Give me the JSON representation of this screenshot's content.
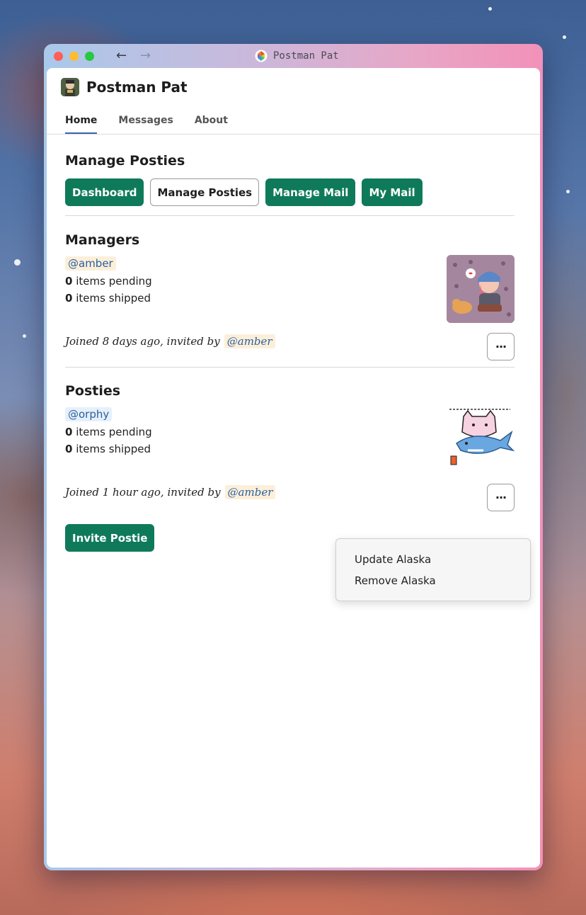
{
  "window": {
    "title": "Postman Pat",
    "back_icon": "arrow-left-icon",
    "forward_icon": "arrow-right-icon"
  },
  "site": {
    "title": "Postman Pat"
  },
  "tabs": [
    {
      "label": "Home",
      "active": true
    },
    {
      "label": "Messages",
      "active": false
    },
    {
      "label": "About",
      "active": false
    }
  ],
  "manage": {
    "title": "Manage Posties",
    "buttons": [
      {
        "label": "Dashboard",
        "style": "filled"
      },
      {
        "label": "Manage Posties",
        "style": "outline"
      },
      {
        "label": "Manage Mail",
        "style": "filled"
      },
      {
        "label": "My Mail",
        "style": "filled"
      }
    ]
  },
  "managers": {
    "title": "Managers",
    "handle": "@amber",
    "pending_count": "0",
    "pending_label": "items pending",
    "shipped_count": "0",
    "shipped_label": "items shipped",
    "joined_text": "Joined 8 days ago, invited by",
    "invited_by": "@amber",
    "more_label": "···"
  },
  "posties": {
    "title": "Posties",
    "handle": "@orphy",
    "pending_count": "0",
    "pending_label": "items pending",
    "shipped_count": "0",
    "shipped_label": "items shipped",
    "joined_text": "Joined 1 hour ago, invited by",
    "invited_by": "@amber",
    "more_label": "···"
  },
  "invite_button": "Invite Postie",
  "dropdown": {
    "items": [
      "Update Alaska",
      "Remove Alaska"
    ]
  },
  "colors": {
    "accent_green": "#0f7a5a",
    "link_blue": "#2a5fa0",
    "tab_underline": "#3b66a8"
  }
}
